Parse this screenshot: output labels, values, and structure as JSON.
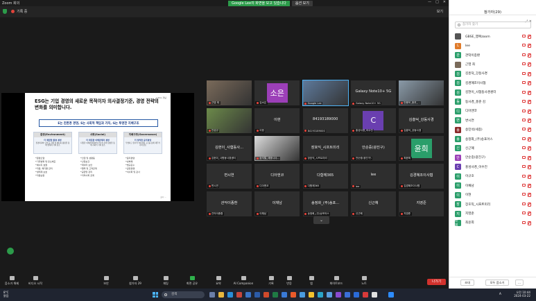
{
  "window": {
    "title": "Zoom 회의",
    "controls": [
      "—",
      "□",
      "✕"
    ]
  },
  "share_banner": {
    "text": "Google Lee의 화면을 보고 있습니다",
    "options_label": "옵션 보기"
  },
  "topstrip": {
    "record_label": "기록 중",
    "view_label": "보기"
  },
  "slide": {
    "page_num": "1 ESG 개념",
    "title": "ESG는 기업 경영의 새로운 목적이자 의사결정기준, 경영 전략의 변화를 의미합니다.",
    "bar": "E는 친환경 경영,    S는 사회적 책임과 가치,    G는 투명한 지배구조",
    "pillars": [
      {
        "head": "환경(Environment)",
        "title": "더 깨끗한 환경 경영",
        "desc": "환경파괴와 오염 등 자원 및 에너지 활용을 통해 생태계 가치 창조",
        "items": [
          "•환경오염",
          "•기후변화 및 탄소배출",
          "•에너지 효율",
          "•자원, 폐기물 관리",
          "•생태계 보호",
          "•자원순환"
        ]
      },
      {
        "head": "사회(Social)",
        "title": "더 따뜻한 이해관계자 경영",
        "desc": "다양한 이해관계자와의 우호적 관계 형성을 통해 사회적 가치 창조",
        "items": [
          "•인권 및 성평등",
          "•산업보건",
          "•데이터 보안",
          "•협력 및 고객관계",
          "•공급망 관리",
          "•지역사회 관계"
        ]
      },
      {
        "head": "지배구조(Governance)",
        "title": "더 정직한 윤리경영",
        "desc": "투명하고 합리적 의사결정 구조를 통해 재무적 가치 창조",
        "items": [
          "•윤리경영",
          "•반부패",
          "•법규준수",
          "•공정경쟁",
          "•이사회 및 감사"
        ]
      }
    ],
    "source": "출처: ..."
  },
  "grid": {
    "tiles": [
      {
        "label": "근영 최",
        "center": "",
        "kind": "photo",
        "color": "#7a6a5a"
      },
      {
        "label": "김소은",
        "center": "소은",
        "kind": "avatar",
        "color": "#9c3fb8"
      },
      {
        "label": "Google Lee",
        "center": "",
        "kind": "photo",
        "color": "#5e7a9c",
        "active": true
      },
      {
        "label": "Galaxy Note10+ 5G",
        "center": "Galaxy Note10+ 5G",
        "kind": "text"
      },
      {
        "label": "안용모_중부_...",
        "center": "",
        "kind": "photo",
        "color": "#8a9aa8"
      },
      {
        "label": "안성규",
        "center": "",
        "kind": "photo",
        "color": "#6c8a4a"
      },
      {
        "label": "이현",
        "center": "이현",
        "kind": "text"
      },
      {
        "label": "84193189000",
        "center": "84193189000",
        "kind": "text"
      },
      {
        "label": "홍성사경_이수진",
        "center": "C",
        "kind": "avatar",
        "color": "#6a3fb0"
      },
      {
        "label": "김흥덕_강동사경",
        "center": "김흥덕_강동사경",
        "kind": "text"
      },
      {
        "label": "김현이_사협동사경센터",
        "center": "김현이_사협동사...",
        "kind": "text"
      },
      {
        "label": "송석철_세종시사...",
        "center": "",
        "kind": "photo",
        "color": "#ddd"
      },
      {
        "label": "장호익_시프트미리",
        "center": "장호익_시프트미리",
        "kind": "text"
      },
      {
        "label": "안순중(광진구)",
        "center": "안순중(광진구)",
        "kind": "text"
      },
      {
        "label": "최윤희",
        "center": "윤희",
        "kind": "avatar",
        "color": "#2a9e6a"
      },
      {
        "label": "변시연",
        "center": "변시연",
        "kind": "text"
      },
      {
        "label": "디아앤코",
        "center": "디아앤코",
        "kind": "text"
      },
      {
        "label": "다함께365",
        "center": "다함께365",
        "kind": "text"
      },
      {
        "label": "lee",
        "center": "lee",
        "kind": "text"
      },
      {
        "label": "김경혜조이사협",
        "center": "김경혜조이사협",
        "kind": "text"
      },
      {
        "label": "관악이종환",
        "center": "관악이종환",
        "kind": "text"
      },
      {
        "label": "이채남",
        "center": "이채남",
        "kind": "text"
      },
      {
        "label": "송정화_(주)송포어스",
        "center": "송정화_(주)송포...",
        "kind": "text"
      },
      {
        "label": "신근혜",
        "center": "신근혜",
        "kind": "text"
      },
      {
        "label": "지영준",
        "center": "지영준",
        "kind": "text"
      }
    ],
    "scroll_label": "⌄"
  },
  "toolbar": {
    "items": [
      {
        "label": "음소거 해제",
        "icon": "mic-icon"
      },
      {
        "label": "비디오 시작",
        "icon": "video-icon"
      },
      {
        "label": "보안",
        "icon": "shield-icon"
      },
      {
        "label": "참가자 29",
        "icon": "participants-icon"
      },
      {
        "label": "채팅",
        "icon": "chat-icon"
      },
      {
        "label": "화면 공유",
        "icon": "share-icon",
        "green": true
      },
      {
        "label": "요약",
        "icon": "summary-icon"
      },
      {
        "label": "AI Companion",
        "icon": "ai-icon"
      },
      {
        "label": "기록",
        "icon": "record-icon"
      },
      {
        "label": "반응",
        "icon": "reaction-icon"
      },
      {
        "label": "앱",
        "icon": "apps-icon"
      },
      {
        "label": "화이트보드",
        "icon": "whiteboard-icon"
      },
      {
        "label": "노트",
        "icon": "notes-icon"
      }
    ],
    "leave_label": "나가기"
  },
  "panel": {
    "title": "참가자(29)",
    "search_placeholder": "참가자 찾기",
    "participants": [
      {
        "name": "GBSE_행복zoom",
        "initial": "",
        "color": "#555"
      },
      {
        "name": "lee",
        "initial": "L",
        "color": "#e07b2a"
      },
      {
        "name": "관악이종환",
        "initial": "관",
        "color": "#2a9e6a"
      },
      {
        "name": "근영 최",
        "initial": "",
        "color": "#7a6a5a"
      },
      {
        "name": "김흥덕_강동사경",
        "initial": "김",
        "color": "#2a9e6a"
      },
      {
        "name": "김경혜조이사협",
        "initial": "김",
        "color": "#2a9e6a"
      },
      {
        "name": "김현이_사협동사경센터",
        "initial": "김",
        "color": "#2a9e6a"
      },
      {
        "name": "동사경_홍준 김",
        "initial": "동",
        "color": "#2a9e6a"
      },
      {
        "name": "디아앤코",
        "initial": "디",
        "color": "#2a9e6a"
      },
      {
        "name": "변시연",
        "initial": "변",
        "color": "#2a9e6a"
      },
      {
        "name": "송민석(세종)",
        "initial": "송",
        "color": "#8a2a2a"
      },
      {
        "name": "송정화_(주)송포어스",
        "initial": "송",
        "color": "#2a9e6a"
      },
      {
        "name": "신근혜",
        "initial": "신",
        "color": "#2a9e6a"
      },
      {
        "name": "안순중(광진구)",
        "initial": "안",
        "color": "#9c3fb8"
      },
      {
        "name": "홍성사경_이수진",
        "initial": "C",
        "color": "#6a3fb0"
      },
      {
        "name": "이규호",
        "initial": "이",
        "color": "#2a9e6a"
      },
      {
        "name": "이채남",
        "initial": "이",
        "color": "#2a9e6a"
      },
      {
        "name": "이현",
        "initial": "이",
        "color": "#2a9e6a"
      },
      {
        "name": "장호익_시프트미리",
        "initial": "장",
        "color": "#2a9e6a"
      },
      {
        "name": "지영준",
        "initial": "지",
        "color": "#2a9e6a"
      },
      {
        "name": "최윤희",
        "initial": "윤희",
        "color": "#2a9e6a"
      }
    ],
    "invite_label": "초대",
    "mute_all_label": "모두 음소거",
    "more_label": "..."
  },
  "taskbar": {
    "weather_temp": "8°C",
    "weather_desc": "맑음",
    "search_placeholder": "검색",
    "lang": "A",
    "time": "오전 10:44",
    "date": "2024-03-22"
  }
}
